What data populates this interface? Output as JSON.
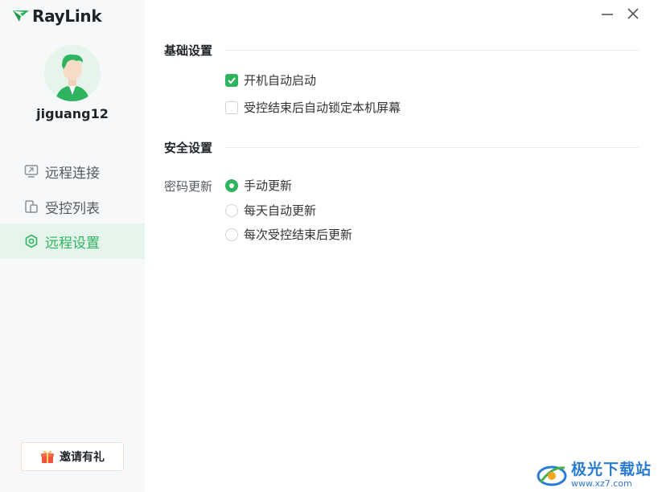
{
  "app": {
    "logo_text": "RayLink"
  },
  "user": {
    "name": "jiguang12"
  },
  "nav": {
    "items": [
      {
        "label": "远程连接",
        "icon": "monitor-icon",
        "active": false
      },
      {
        "label": "受控列表",
        "icon": "devices-icon",
        "active": false
      },
      {
        "label": "远程设置",
        "icon": "settings-hexagon-icon",
        "active": true
      }
    ]
  },
  "invite": {
    "label": "邀请有礼",
    "icon": "gift-icon"
  },
  "basic": {
    "title": "基础设置",
    "options": [
      {
        "label": "开机自动启动",
        "checked": true
      },
      {
        "label": "受控结束后自动锁定本机屏幕",
        "checked": false
      }
    ]
  },
  "security": {
    "title": "安全设置",
    "password_label": "密码更新",
    "options": [
      {
        "label": "手动更新",
        "selected": true
      },
      {
        "label": "每天自动更新",
        "selected": false
      },
      {
        "label": "每次受控结束后更新",
        "selected": false
      }
    ]
  },
  "watermark": {
    "main": "极光下载站",
    "sub": "www.xz7.com"
  },
  "colors": {
    "accent": "#2eb35e",
    "sidebar_bg": "#f7f8fa",
    "active_bg": "#e6f5ec"
  }
}
